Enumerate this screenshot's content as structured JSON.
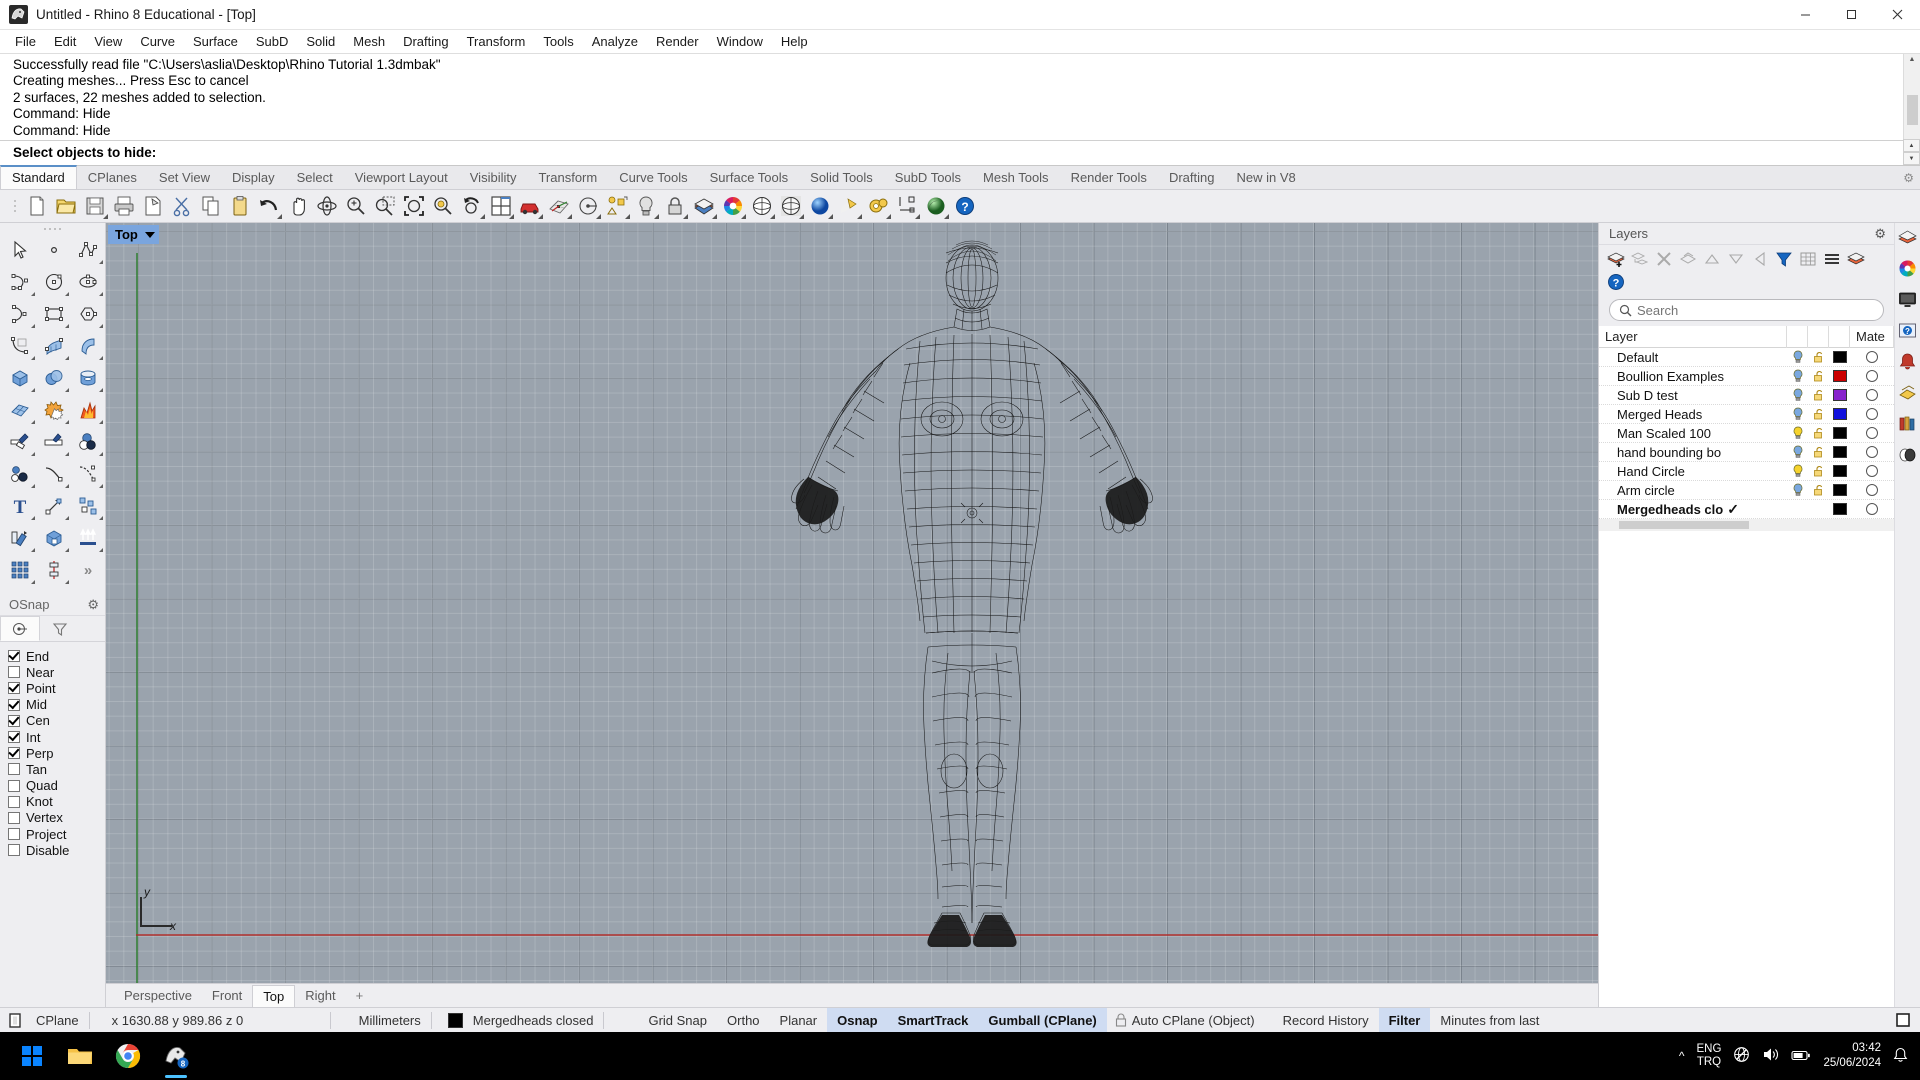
{
  "window": {
    "title": "Untitled - Rhino 8 Educational - [Top]",
    "app_icon": "rhino-logo-icon",
    "minimize": "—",
    "maximize": "⬜",
    "close": "✕"
  },
  "menubar": {
    "items": [
      {
        "label": "File"
      },
      {
        "label": "Edit"
      },
      {
        "label": "View"
      },
      {
        "label": "Curve"
      },
      {
        "label": "Surface"
      },
      {
        "label": "SubD"
      },
      {
        "label": "Solid"
      },
      {
        "label": "Mesh"
      },
      {
        "label": "Drafting"
      },
      {
        "label": "Transform"
      },
      {
        "label": "Tools"
      },
      {
        "label": "Analyze"
      },
      {
        "label": "Render"
      },
      {
        "label": "Window"
      },
      {
        "label": "Help"
      }
    ]
  },
  "command": {
    "history": [
      "Successfully read file \"C:\\Users\\aslia\\Desktop\\Rhino Tutorial 1.3dmbak\"",
      "Creating meshes... Press Esc to cancel",
      "2 surfaces, 22 meshes added to selection.",
      "Command: Hide",
      "Command: Hide"
    ],
    "prompt": "Select objects to hide:"
  },
  "toolbar_tabs": {
    "active": "Standard",
    "items": [
      {
        "label": "Standard"
      },
      {
        "label": "CPlanes"
      },
      {
        "label": "Set View"
      },
      {
        "label": "Display"
      },
      {
        "label": "Select"
      },
      {
        "label": "Viewport Layout"
      },
      {
        "label": "Visibility"
      },
      {
        "label": "Transform"
      },
      {
        "label": "Curve Tools"
      },
      {
        "label": "Surface Tools"
      },
      {
        "label": "Solid Tools"
      },
      {
        "label": "SubD Tools"
      },
      {
        "label": "Mesh Tools"
      },
      {
        "label": "Render Tools"
      },
      {
        "label": "Drafting"
      },
      {
        "label": "New in V8"
      }
    ]
  },
  "main_toolbar": {
    "buttons": [
      {
        "name": "new-file-icon",
        "flyout": false
      },
      {
        "name": "open-file-icon",
        "flyout": false
      },
      {
        "name": "save-file-icon",
        "flyout": true
      },
      {
        "name": "print-icon",
        "flyout": false
      },
      {
        "name": "copy-to-clipboard-icon",
        "flyout": false
      },
      {
        "name": "cut-icon",
        "flyout": false
      },
      {
        "name": "copy-icon",
        "flyout": false
      },
      {
        "name": "paste-icon",
        "flyout": false
      },
      {
        "name": "undo-icon",
        "flyout": true
      },
      {
        "name": "pan-icon",
        "flyout": false
      },
      {
        "name": "rotate-view-icon",
        "flyout": false
      },
      {
        "name": "zoom-in-icon",
        "flyout": false
      },
      {
        "name": "zoom-window-icon",
        "flyout": false
      },
      {
        "name": "zoom-extents-icon",
        "flyout": false
      },
      {
        "name": "zoom-selected-icon",
        "flyout": false
      },
      {
        "name": "undo-view-change-icon",
        "flyout": true
      },
      {
        "name": "viewport-layout-icon",
        "flyout": true
      },
      {
        "name": "car-render-icon",
        "flyout": true
      },
      {
        "name": "cplane-grid-icon",
        "flyout": true
      },
      {
        "name": "named-cplane-icon",
        "flyout": true
      },
      {
        "name": "object-snap-icon",
        "flyout": true
      },
      {
        "name": "light-bulb-icon",
        "flyout": true
      },
      {
        "name": "lock-icon",
        "flyout": true
      },
      {
        "name": "layers-icon",
        "flyout": true
      },
      {
        "name": "color-wheel-icon",
        "flyout": true
      },
      {
        "name": "shade-icon",
        "flyout": true
      },
      {
        "name": "ghosted-view-icon",
        "flyout": true
      },
      {
        "name": "render-preview-icon",
        "flyout": true
      },
      {
        "name": "render-icon",
        "flyout": true
      },
      {
        "name": "options-gear-icon",
        "flyout": true
      },
      {
        "name": "dimension-icon",
        "flyout": true
      },
      {
        "name": "environment-icon",
        "flyout": true
      },
      {
        "name": "help-icon",
        "flyout": false
      }
    ]
  },
  "left_toolbar": {
    "buttons": [
      {
        "name": "select-arrow-icon"
      },
      {
        "name": "point-icon"
      },
      {
        "name": "polyline-icon"
      },
      {
        "name": "curve-interpolate-icon"
      },
      {
        "name": "circle-icon"
      },
      {
        "name": "ellipse-icon"
      },
      {
        "name": "arc-icon"
      },
      {
        "name": "rectangle-icon"
      },
      {
        "name": "polygon-icon"
      },
      {
        "name": "fillet-curve-icon"
      },
      {
        "name": "surface-from-curves-icon"
      },
      {
        "name": "extrude-surface-icon"
      },
      {
        "name": "box-icon"
      },
      {
        "name": "sphere-boolean-icon"
      },
      {
        "name": "cylinder-icon"
      },
      {
        "name": "mesh-icon"
      },
      {
        "name": "boolean-union-icon"
      },
      {
        "name": "explode-icon"
      },
      {
        "name": "trim-icon"
      },
      {
        "name": "split-icon"
      },
      {
        "name": "boolean-difference-icon"
      },
      {
        "name": "offset-icon"
      },
      {
        "name": "blend-curve-icon"
      },
      {
        "name": "curve-from-objects-icon"
      },
      {
        "name": "text-icon"
      },
      {
        "name": "move-icon"
      },
      {
        "name": "copy-objects-icon"
      },
      {
        "name": "rotate-icon"
      },
      {
        "name": "orient-icon"
      },
      {
        "name": "array-direction-icon"
      },
      {
        "name": "rectangular-array-icon"
      },
      {
        "name": "mirror-icon"
      },
      {
        "name": "more-tools-icon"
      }
    ],
    "more_label": "»"
  },
  "osnap": {
    "title": "OSnap",
    "gear_icon": "gear-icon",
    "tabs": [
      {
        "name": "osnap-tab-icon",
        "active": true
      },
      {
        "name": "filter-tab-icon",
        "active": false
      }
    ],
    "items": [
      {
        "label": "End",
        "checked": true
      },
      {
        "label": "Near",
        "checked": false
      },
      {
        "label": "Point",
        "checked": true
      },
      {
        "label": "Mid",
        "checked": true
      },
      {
        "label": "Cen",
        "checked": true
      },
      {
        "label": "Int",
        "checked": true
      },
      {
        "label": "Perp",
        "checked": true
      },
      {
        "label": "Tan",
        "checked": false
      },
      {
        "label": "Quad",
        "checked": false
      },
      {
        "label": "Knot",
        "checked": false
      },
      {
        "label": "Vertex",
        "checked": false
      },
      {
        "label": "Project",
        "checked": false
      },
      {
        "label": "Disable",
        "checked": false
      }
    ]
  },
  "viewport": {
    "label": "Top",
    "axis_x_label": "x",
    "axis_y_label": "y",
    "model": "human-body-mesh-wireframe",
    "tabs": [
      {
        "label": "Perspective",
        "active": false
      },
      {
        "label": "Front",
        "active": false
      },
      {
        "label": "Top",
        "active": true
      },
      {
        "label": "Right",
        "active": false
      }
    ],
    "add_tab": "+"
  },
  "layers_panel": {
    "title": "Layers",
    "gear_icon": "gear-icon",
    "tools": [
      {
        "name": "new-layer-icon"
      },
      {
        "name": "new-sublayer-icon"
      },
      {
        "name": "delete-layer-icon"
      },
      {
        "name": "duplicate-layer-icon"
      },
      {
        "name": "move-layer-up-icon"
      },
      {
        "name": "move-layer-down-icon"
      },
      {
        "name": "move-layer-left-icon"
      },
      {
        "name": "filter-icon"
      },
      {
        "name": "layer-grid-icon"
      },
      {
        "name": "layer-menu-icon"
      },
      {
        "name": "layer-panel-icon"
      },
      {
        "name": "help-icon"
      }
    ],
    "search_placeholder": "Search",
    "search_value": "",
    "columns": [
      {
        "label": "Layer"
      },
      {
        "label": ""
      },
      {
        "label": ""
      },
      {
        "label": ""
      },
      {
        "label": "Mate"
      }
    ],
    "rows": [
      {
        "name": "Default",
        "visible": true,
        "bulb": "blue",
        "locked": false,
        "color": "#000000",
        "current": false
      },
      {
        "name": "Boullion Examples",
        "visible": true,
        "bulb": "blue",
        "locked": false,
        "color": "#cc0000",
        "current": false
      },
      {
        "name": "Sub D test",
        "visible": true,
        "bulb": "blue",
        "locked": false,
        "color": "#8822cc",
        "current": false
      },
      {
        "name": "Merged Heads",
        "visible": true,
        "bulb": "blue",
        "locked": false,
        "color": "#1111dd",
        "current": false
      },
      {
        "name": "Man Scaled 100",
        "visible": true,
        "bulb": "yellow",
        "locked": false,
        "color": "#000000",
        "current": false
      },
      {
        "name": "hand bounding bo",
        "visible": true,
        "bulb": "blue",
        "locked": false,
        "color": "#000000",
        "current": false
      },
      {
        "name": "Hand Circle",
        "visible": true,
        "bulb": "yellow",
        "locked": false,
        "color": "#000000",
        "current": false
      },
      {
        "name": "Arm circle",
        "visible": true,
        "bulb": "blue",
        "locked": false,
        "color": "#000000",
        "current": false
      },
      {
        "name": "Mergedheads clo",
        "visible": false,
        "bulb": "none",
        "locked": false,
        "color": "#000000",
        "current": true,
        "check": "✓"
      }
    ]
  },
  "right_rail": {
    "icons": [
      {
        "name": "layers-rail-icon"
      },
      {
        "name": "color-wheel-rail-icon"
      },
      {
        "name": "display-rail-icon"
      },
      {
        "name": "help-rail-icon"
      },
      {
        "name": "notification-bell-rail-icon"
      },
      {
        "name": "materials-rail-icon"
      },
      {
        "name": "library-rail-icon"
      },
      {
        "name": "render-rail-icon"
      }
    ]
  },
  "statusbar": {
    "cplane_icon": "cplane-icon",
    "cplane_label": "CPlane",
    "coordinates": "x 1630.88  y 989.86  z 0",
    "units": "Millimeters",
    "layer_color": "#000000",
    "layer_name": "Mergedheads closed",
    "toggles": [
      {
        "label": "Grid Snap",
        "on": false
      },
      {
        "label": "Ortho",
        "on": false
      },
      {
        "label": "Planar",
        "on": false
      },
      {
        "label": "Osnap",
        "on": true
      },
      {
        "label": "SmartTrack",
        "on": true
      },
      {
        "label": "Gumball (CPlane)",
        "on": true
      }
    ],
    "auto_cplane": "Auto CPlane (Object)",
    "auto_cplane_icon": "lock-icon",
    "record_history": "Record History",
    "filter": {
      "label": "Filter",
      "on": true
    },
    "minutes_from_last": "Minutes from last"
  },
  "taskbar": {
    "start_icon": "windows-logo-icon",
    "apps": [
      {
        "name": "file-explorer-icon",
        "active": false
      },
      {
        "name": "chrome-icon",
        "active": false
      },
      {
        "name": "rhino-icon",
        "active": true,
        "badge": "8"
      }
    ],
    "chevron_icon": "chevron-up-icon",
    "lang_top": "ENG",
    "lang_bottom": "TRQ",
    "tray_icons": [
      "network-blocked-icon",
      "volume-icon",
      "battery-icon"
    ],
    "time": "03:42",
    "date": "25/06/2024",
    "bell_icon": "notification-bell-icon"
  }
}
